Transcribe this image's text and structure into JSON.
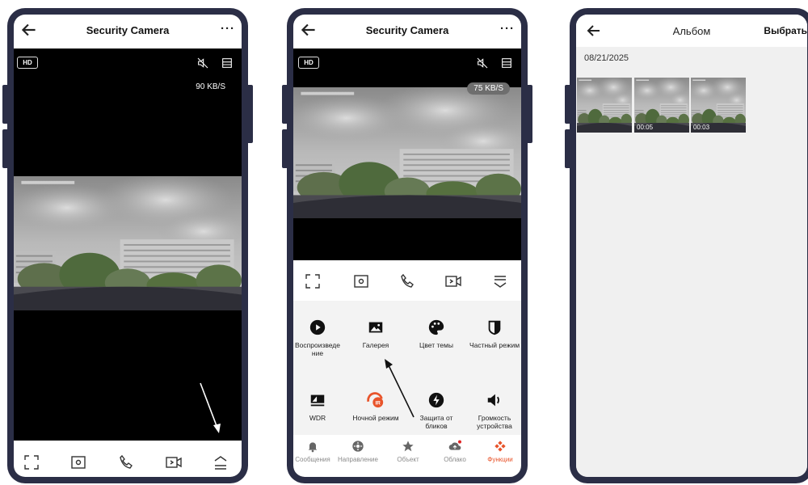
{
  "phone1": {
    "app_title": "Security Camera",
    "more_label": "···",
    "hd_label": "HD",
    "bitrate": "90 KB/S",
    "icons": [
      "back-arrow-icon",
      "more-icon",
      "speaker-mute-icon",
      "layout-icon",
      "fullscreen-icon",
      "screenshot-icon",
      "call-icon",
      "record-icon",
      "expand-up-icon"
    ]
  },
  "phone2": {
    "app_title": "Security Camera",
    "more_label": "···",
    "hd_label": "HD",
    "bitrate": "75 KB/S",
    "functions": [
      {
        "label": "Воспроизведе ние",
        "icon": "play-icon"
      },
      {
        "label": "Галерея",
        "icon": "gallery-icon"
      },
      {
        "label": "Цвет темы",
        "icon": "palette-icon"
      },
      {
        "label": "Частный режим",
        "icon": "shield-icon"
      },
      {
        "label": "WDR",
        "icon": "wdr-icon"
      },
      {
        "label": "Ночной режим",
        "icon": "night-ir-icon"
      },
      {
        "label": "Защита от бликов",
        "icon": "flash-icon"
      },
      {
        "label": "Громкость устройства",
        "icon": "volume-icon"
      }
    ],
    "tabs": [
      {
        "label": "Сообщения",
        "icon": "bell-icon"
      },
      {
        "label": "Направление",
        "icon": "joystick-icon"
      },
      {
        "label": "Объект",
        "icon": "star-icon"
      },
      {
        "label": "Облако",
        "icon": "cloud-icon"
      },
      {
        "label": "Функции",
        "icon": "functions-icon",
        "active": true
      }
    ]
  },
  "phone3": {
    "title": "Альбом",
    "select_label": "Выбрать",
    "date": "08/21/2025",
    "thumbs": [
      {
        "duration": ""
      },
      {
        "duration": "00:05"
      },
      {
        "duration": "00:03"
      }
    ]
  },
  "colors": {
    "frame": "#2b2e46",
    "accent": "#e8542b",
    "panel": "#f3f3f3"
  }
}
